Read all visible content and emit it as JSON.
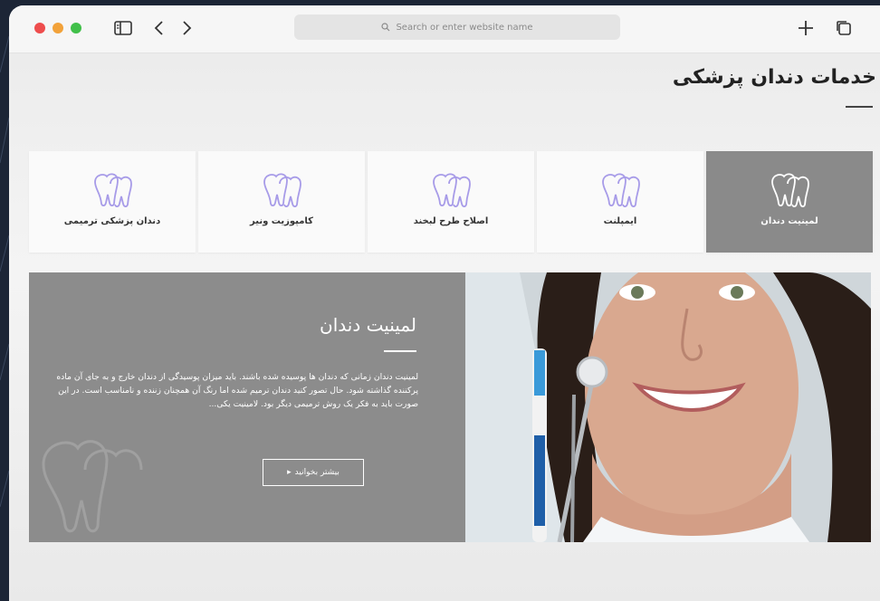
{
  "browser": {
    "address_placeholder": "Search or enter website name",
    "icons": [
      "sidebar-icon",
      "back-icon",
      "forward-icon",
      "new-tab-icon",
      "tabs-icon",
      "search-icon"
    ]
  },
  "page": {
    "title": "خدمات دندان پزشکی"
  },
  "services": [
    {
      "label": "لمینیت دندان",
      "active": true,
      "icon": "tooth-icon"
    },
    {
      "label": "ایمپلنت",
      "active": false,
      "icon": "tooth-icon"
    },
    {
      "label": "اصلاح طرح لبخند",
      "active": false,
      "icon": "tooth-icon"
    },
    {
      "label": "کامپوزیت ونیر",
      "active": false,
      "icon": "tooth-icon"
    },
    {
      "label": "دندان پزشکی ترمیمی",
      "active": false,
      "icon": "tooth-icon"
    }
  ],
  "feature": {
    "title": "لمینیت دندان",
    "text": "لمینیت دندان زمانی که دندان ها پوسیده شده باشند. باید میزان پوسیدگی از دندان خارج و به جای آن ماده پرکننده گذاشته شود. حال تصور کنید دندان ترمیم شده اما رنگ آن همچنان زننده و نامناسب است. در این صورت باید به فکر یک روش ترمیمی دیگر بود. لامینیت یکی...",
    "button_label": "بیشتر بخوانید",
    "button_icon": "chevron-right-icon",
    "image": "smiling-woman-dental-photo"
  },
  "colors": {
    "active_card": "#8a8a8a",
    "feature_panel": "#8c8c8c",
    "tooth_icon": "#a79be8"
  }
}
